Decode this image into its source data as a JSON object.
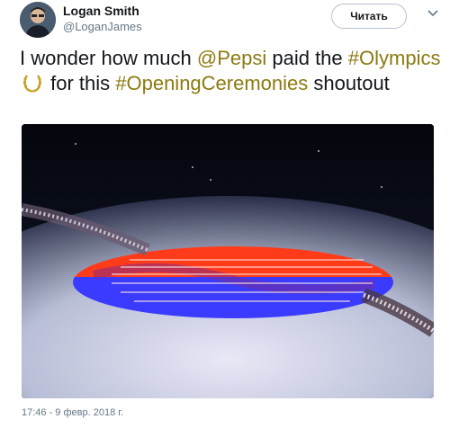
{
  "author": {
    "name": "Logan Smith",
    "handle": "@LoganJames"
  },
  "follow_button": {
    "label": "Читать"
  },
  "tweet": {
    "part1": "I wonder how much ",
    "mention": "@Pepsi",
    "part2": " paid the ",
    "hashtag1": "#Olympics",
    "part3": " for this ",
    "hashtag2": "#OpeningCeremonies",
    "part4": " shoutout"
  },
  "timestamp": "17:46 - 9 февр. 2018 г.",
  "icons": {
    "menu": "chevron-down-icon",
    "emoji": "laurel-wreath-icon",
    "avatar": "avatar"
  },
  "colors": {
    "link": "#8c7a10",
    "text": "#14171a",
    "secondary": "#657786",
    "flag_red": "#ff3b1a",
    "flag_blue": "#3b3bff"
  }
}
